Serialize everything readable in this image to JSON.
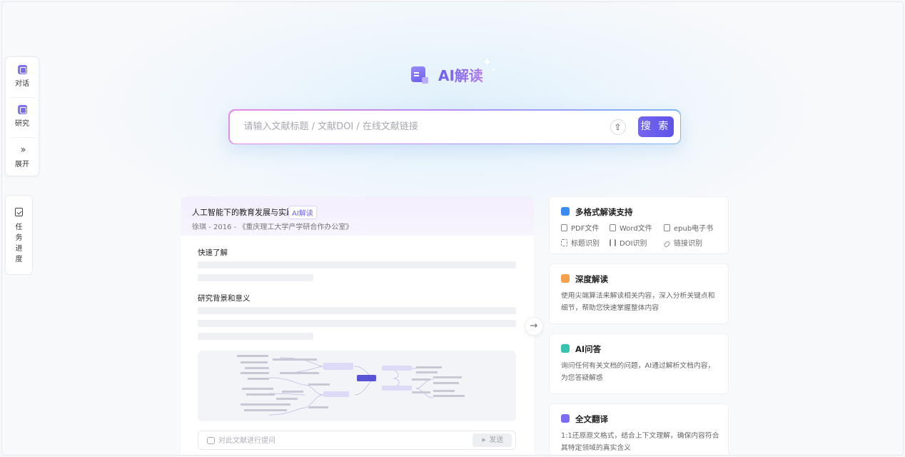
{
  "sidebar": {
    "items": [
      {
        "label": "对话",
        "icon": "chat-icon"
      },
      {
        "label": "研究",
        "icon": "research-icon"
      },
      {
        "label": "展开",
        "icon": "expand-icon"
      }
    ],
    "task_label": "任务进度"
  },
  "hero": {
    "title": "AI解读",
    "search_placeholder": "请输入文献标题 / 文献DOI / 在线文献链接",
    "search_button": "搜 索"
  },
  "preview": {
    "title": "人工智能下的教育发展与实践",
    "tag": "AI解读",
    "meta": "徐琪 - 2016 - 《重庆理工大学产学研合作办公室》",
    "section1": "快速了解",
    "section2": "研究背景和意义",
    "ask_placeholder": "对此文献进行提问",
    "send_label": "发送"
  },
  "features": [
    {
      "title": "多格式解读支持",
      "icon": "layers-icon",
      "color": "#3b8cf0",
      "formats": [
        "PDF文件",
        "Word文件",
        "epub电子书",
        "标题识别",
        "DOI识别",
        "链接识别"
      ]
    },
    {
      "title": "深度解读",
      "icon": "deep-read-icon",
      "color": "#f5a04a",
      "desc": "使用尖端算法来解读相关内容，深入分析关键点和细节，帮助您快速掌握整体内容"
    },
    {
      "title": "AI问答",
      "icon": "qa-icon",
      "color": "#38c2b0",
      "desc": "询问任何有关文档的问题，AI通过解析文档内容，为您答疑解惑"
    },
    {
      "title": "全文翻译",
      "icon": "translate-icon",
      "color": "#7b6cf2",
      "desc": "1:1还原原文格式，结合上下文理解，确保内容符合其特定领域的真实含义"
    }
  ]
}
